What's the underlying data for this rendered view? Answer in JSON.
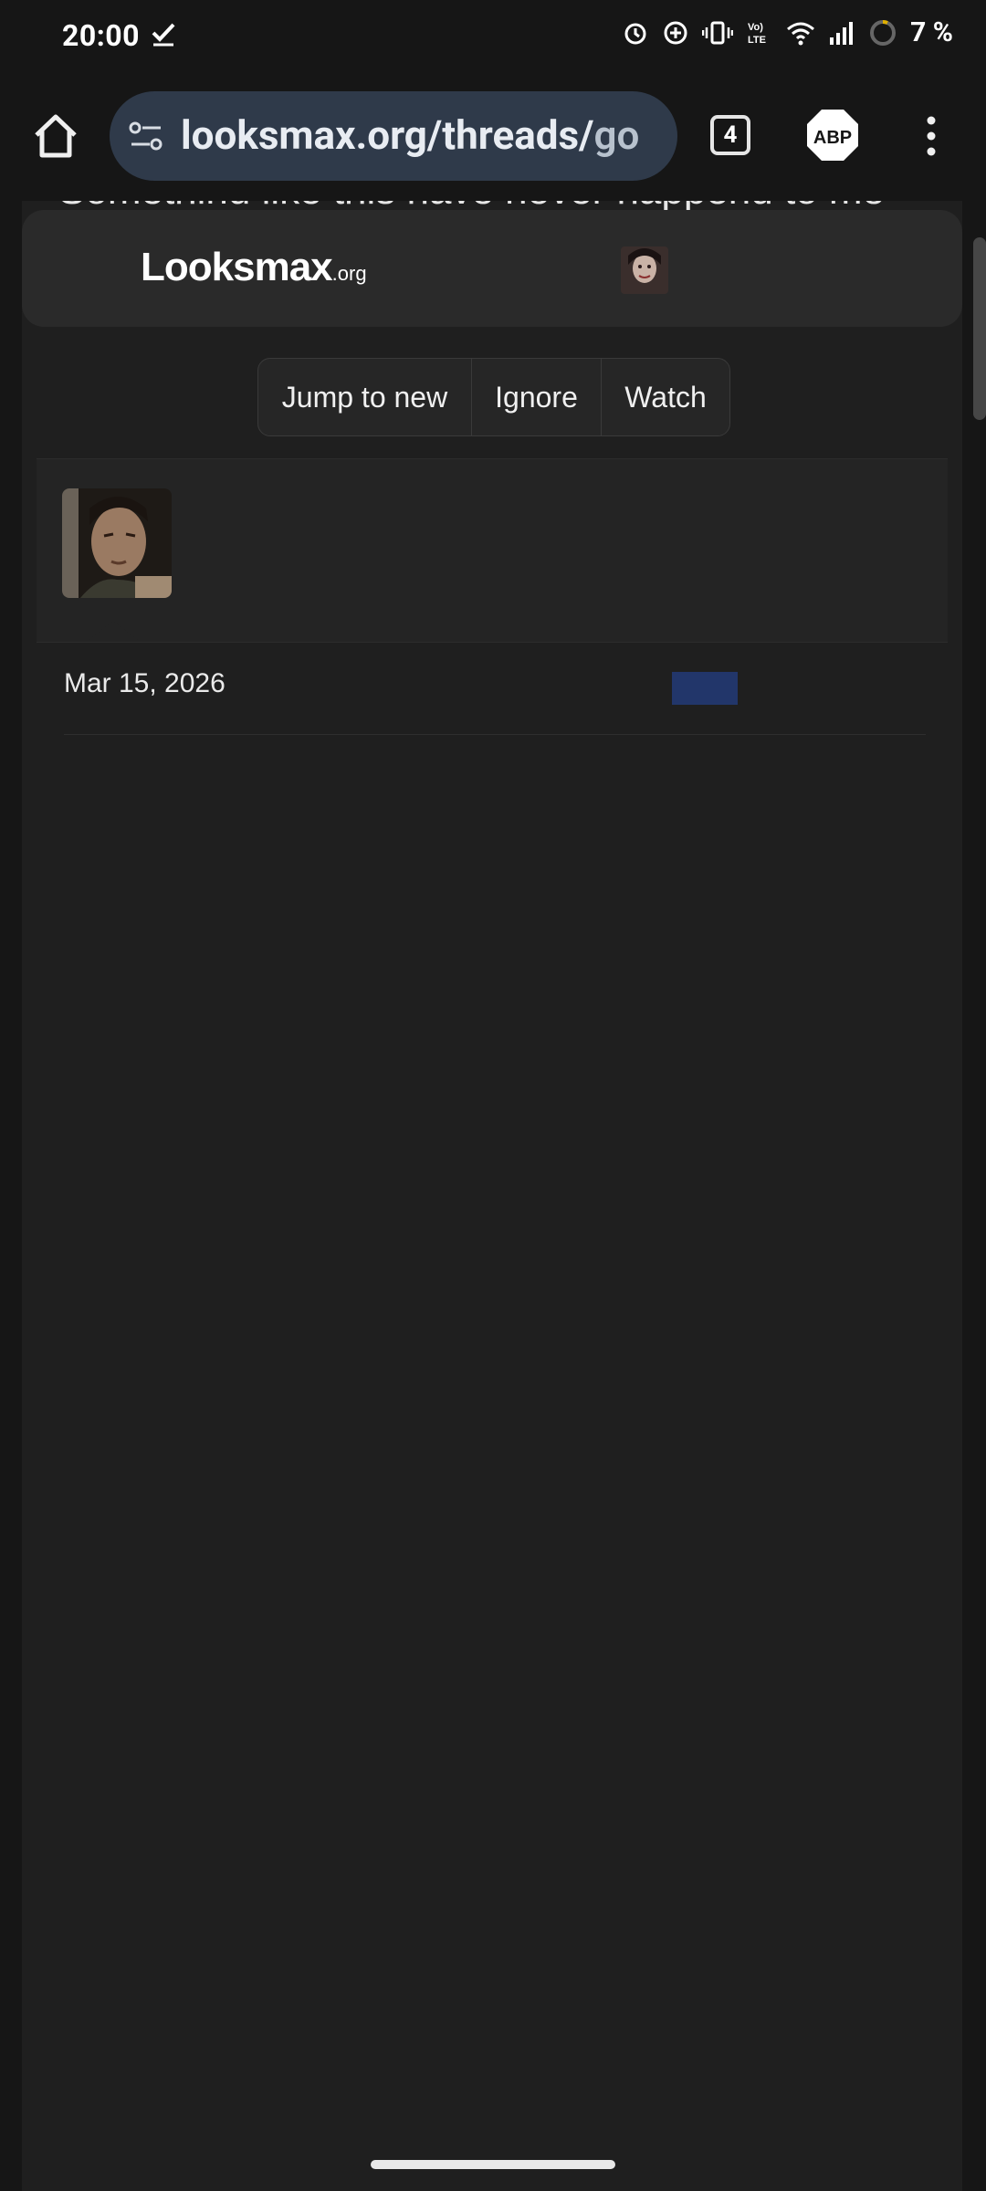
{
  "status_bar": {
    "time": "20:00",
    "battery": "7 %",
    "icons": [
      "check-icon",
      "alarm-icon",
      "data-saver-icon",
      "vibrate-icon",
      "volte-icon",
      "wifi-icon",
      "signal-icon",
      "battery-icon"
    ]
  },
  "browser": {
    "url_main": "looksmax.org/threads/",
    "url_tail": "go",
    "tab_count": "4",
    "abp_label": "ABP"
  },
  "page": {
    "behind_title": "Somethind like this have never happend to me",
    "logo_main": "Looksmax",
    "logo_org": ".org",
    "actions": {
      "jump": "Jump to new",
      "ignore": "Ignore",
      "watch": "Watch"
    },
    "post": {
      "date": "Mar 15, 2026"
    }
  },
  "colors": {
    "background": "#1f1f1f",
    "header": "#2a2a2a",
    "url_bar": "#2f3a4a",
    "badge": "#22366a"
  }
}
